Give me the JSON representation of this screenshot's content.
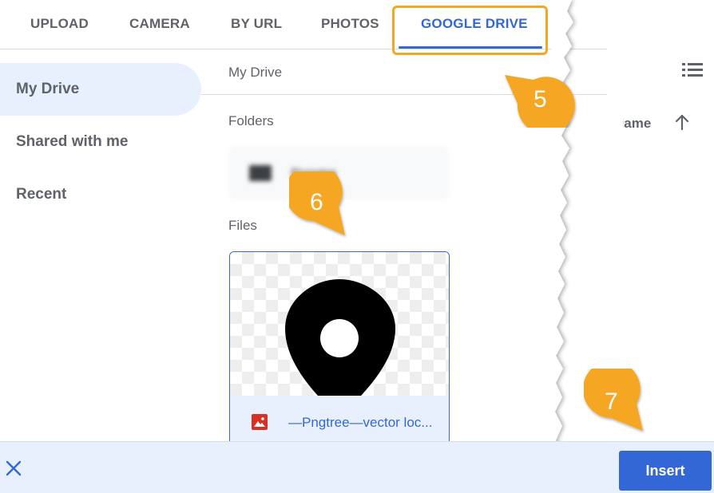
{
  "tabs": [
    {
      "label": "UPLOAD",
      "active": false
    },
    {
      "label": "CAMERA",
      "active": false
    },
    {
      "label": "BY URL",
      "active": false
    },
    {
      "label": "PHOTOS",
      "active": false
    },
    {
      "label": "GOOGLE DRIVE",
      "active": true
    }
  ],
  "sidebar": {
    "items": [
      {
        "label": "My Drive",
        "active": true
      },
      {
        "label": "Shared with me",
        "active": false
      },
      {
        "label": "Recent",
        "active": false
      }
    ]
  },
  "header": {
    "breadcrumb": "My Drive",
    "sort_label": "Name"
  },
  "sections": {
    "folders_label": "Folders",
    "files_label": "Files"
  },
  "folder": {
    "name": "Pixnotes"
  },
  "file": {
    "name": "—Pngtree—vector loc..."
  },
  "footer": {
    "insert_label": "Insert"
  },
  "callouts": [
    "5",
    "6",
    "7"
  ],
  "colors": {
    "accent": "#3367d6",
    "callout": "#f5a623",
    "selected_bg": "#e8f0fe",
    "image_icon": "#d93025"
  },
  "icons": {
    "list_view": "list-view-icon",
    "sort": "arrow-up-icon",
    "close": "close-icon",
    "folder": "folder-icon",
    "image": "image-icon",
    "thumbnail": "map-pin-icon"
  }
}
